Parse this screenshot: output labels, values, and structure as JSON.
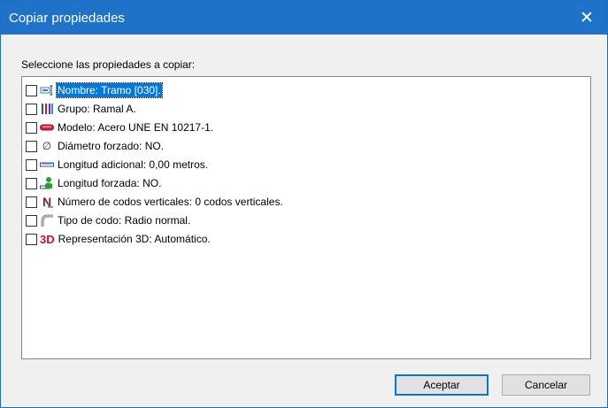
{
  "window": {
    "title": "Copiar propiedades",
    "close_glyph": "✕"
  },
  "prompt": "Seleccione las propiedades a copiar:",
  "items": [
    {
      "label": "Nombre: Tramo [030].",
      "icon": "name-tag-icon",
      "checked": false,
      "selected": true
    },
    {
      "label": "Grupo: Ramal A.",
      "icon": "group-bars-icon",
      "checked": false,
      "selected": false
    },
    {
      "label": "Modelo: Acero UNE EN 10217-1.",
      "icon": "pipe-model-icon",
      "checked": false,
      "selected": false
    },
    {
      "label": "Diámetro forzado: NO.",
      "icon": "diameter-icon",
      "checked": false,
      "selected": false
    },
    {
      "label": "Longitud adicional: 0,00 metros.",
      "icon": "ruler-icon",
      "checked": false,
      "selected": false
    },
    {
      "label": "Longitud forzada: NO.",
      "icon": "forced-length-icon",
      "checked": false,
      "selected": false
    },
    {
      "label": "Número de codos verticales: 0 codos verticales.",
      "icon": "vertical-elbows-icon",
      "checked": false,
      "selected": false
    },
    {
      "label": "Tipo de codo: Radio normal.",
      "icon": "elbow-type-icon",
      "checked": false,
      "selected": false
    },
    {
      "label": "Representación 3D: Automático.",
      "icon": "3d-icon",
      "checked": false,
      "selected": false
    }
  ],
  "icon_text": {
    "diameter": "∅",
    "three_d": "3D",
    "n_letter": "N"
  },
  "buttons": {
    "accept": "Aceptar",
    "cancel": "Cancelar"
  },
  "colors": {
    "titlebar": "#1e73c8",
    "selection": "#0078d7",
    "three_d": "#d4102a"
  }
}
